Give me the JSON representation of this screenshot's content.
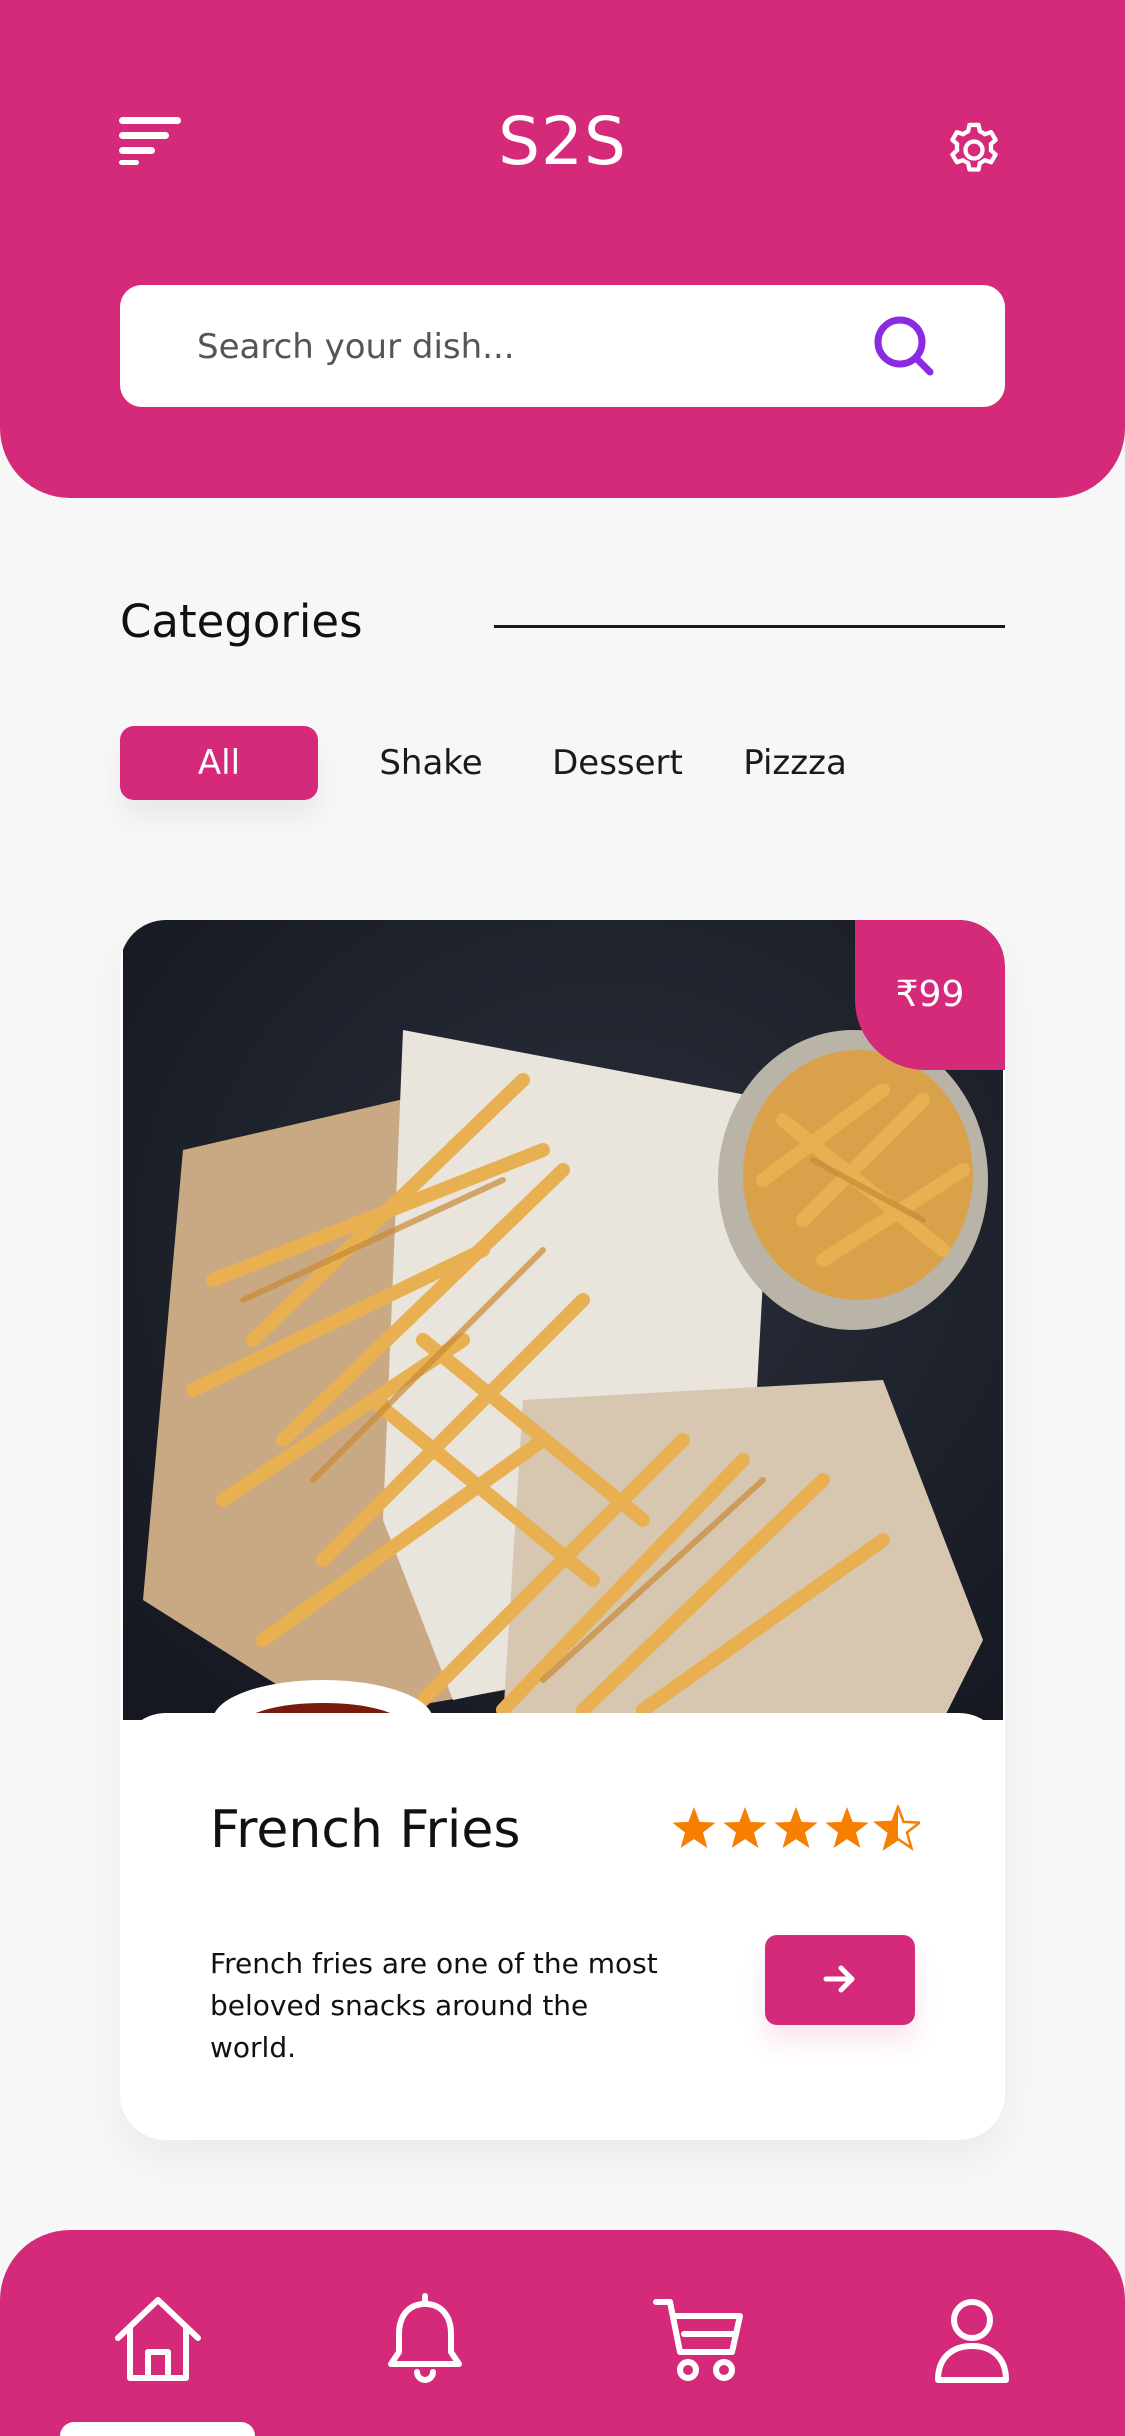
{
  "header": {
    "title": "S2S",
    "menu_icon": "menu-icon",
    "settings_icon": "gear-icon"
  },
  "search": {
    "placeholder": "Search your dish...",
    "icon": "search-icon"
  },
  "categories": {
    "title": "Categories",
    "chips": [
      {
        "label": "All",
        "active": true
      },
      {
        "label": "Shake",
        "active": false
      },
      {
        "label": "Dessert",
        "active": false
      },
      {
        "label": "Pizzza",
        "active": false
      }
    ]
  },
  "food_card": {
    "price": "₹99",
    "name": "French Fries",
    "rating": 4.5,
    "rating_max": 5,
    "description": "French fries are one of the most beloved snacks around the world.",
    "button_icon": "arrow-right-icon"
  },
  "bottom_nav": {
    "items": [
      "home-icon",
      "bell-icon",
      "cart-icon",
      "user-icon"
    ]
  },
  "colors": {
    "brand": "#d42a79",
    "search_icon": "#8a2be2",
    "star": "#f77f00",
    "background": "#f7f7f7"
  }
}
